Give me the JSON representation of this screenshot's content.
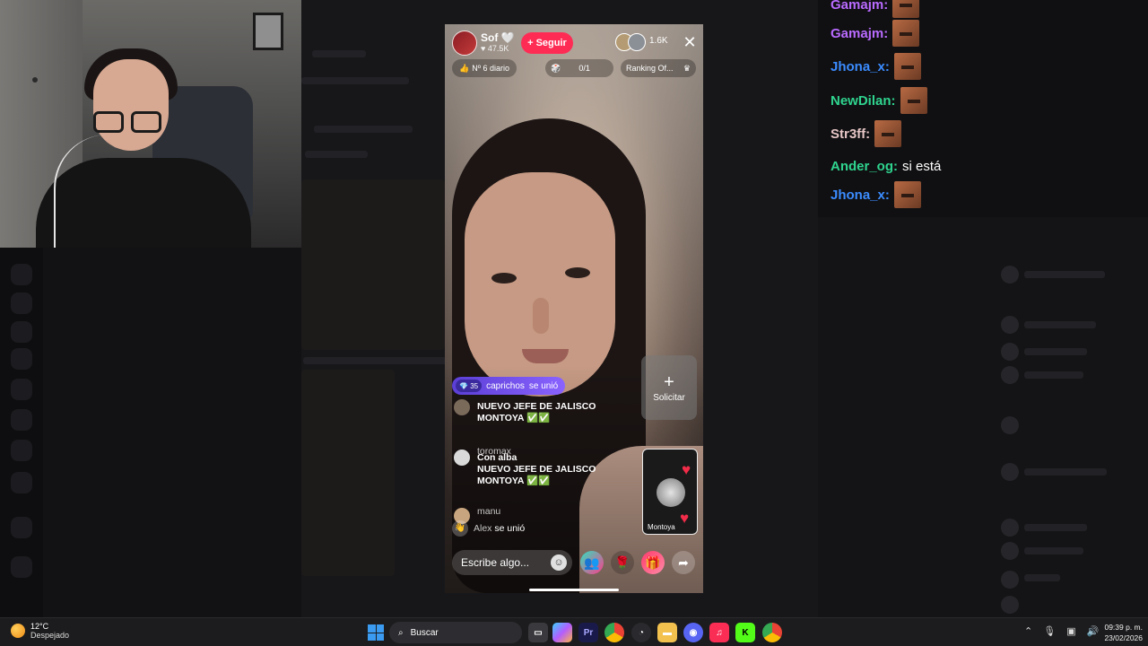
{
  "stream": {
    "host_name": "Sof 🤍",
    "host_likes": "47.5K",
    "follow_label": "Seguir",
    "viewer_count": "1.6K",
    "daily_rank": "Nº 6 diario",
    "goal_progress": "0/1",
    "ranking_label": "Ranking Of...",
    "join_banner": {
      "level": "35",
      "user": "caprichos",
      "action": "se unió"
    },
    "comments": [
      {
        "user": "",
        "text": "NUEVO JEFE DE JALISCO MONTOYA ✅✅"
      },
      {
        "user": "toromax",
        "text": "Con alba"
      },
      {
        "user": "",
        "text": "NUEVO JEFE DE JALISCO MONTOYA ✅✅"
      },
      {
        "user": "manu",
        "text": ""
      }
    ],
    "join_line": {
      "user": "Alex",
      "action": "se unió"
    },
    "request_label": "Solicitar",
    "guest_name": "Montoya",
    "comment_placeholder": "Escribe algo...",
    "icons": [
      "emoji-icon",
      "multi-guest-icon",
      "rose-icon",
      "gift-icon",
      "share-icon"
    ]
  },
  "chat": {
    "messages": [
      {
        "user": "Gamajm:",
        "color": "#b96bff",
        "text": "",
        "emote": true
      },
      {
        "user": "Gamajm:",
        "color": "#b96bff",
        "text": "",
        "emote": true
      },
      {
        "user": "Jhona_x:",
        "color": "#3b8cff",
        "text": "",
        "emote": true
      },
      {
        "user": "NewDilan:",
        "color": "#2fd48f",
        "text": "",
        "emote": true
      },
      {
        "user": "Str3ff:",
        "color": "#e7c6c6",
        "text": "",
        "emote": true
      },
      {
        "user": "Ander_og:",
        "color": "#2fd48f",
        "text": "si está",
        "emote": false
      },
      {
        "user": "Jhona_x:",
        "color": "#3b8cff",
        "text": "",
        "emote": true
      }
    ]
  },
  "taskbar": {
    "weather_temp": "12°C",
    "weather_desc": "Despejado",
    "search_label": "Buscar",
    "time": "09:39 p. m.",
    "date": "23/02/2026"
  }
}
